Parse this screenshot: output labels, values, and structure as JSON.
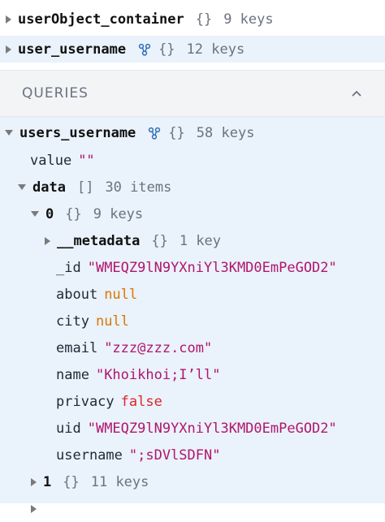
{
  "top_items": [
    {
      "key": "userObject_container",
      "type": "{}",
      "count": "9 keys"
    },
    {
      "key": "user_username",
      "type": "{}",
      "count": "12 keys"
    }
  ],
  "queries": {
    "title": "QUERIES",
    "root": {
      "key": "users_username",
      "type": "{}",
      "count": "58 keys"
    },
    "value": {
      "key": "value",
      "val": "\"\""
    },
    "data": {
      "key": "data",
      "type": "[]",
      "count": "30 items"
    },
    "item0": {
      "key": "0",
      "type": "{}",
      "count": "9 keys"
    },
    "metadata": {
      "key": "__metadata",
      "type": "{}",
      "count": "1 key"
    },
    "fields": [
      {
        "key": "_id",
        "val": "\"WMEQZ9lN9YXniYl3KMD0EmPeGOD2\"",
        "kind": "str"
      },
      {
        "key": "about",
        "val": "null",
        "kind": "null"
      },
      {
        "key": "city",
        "val": "null",
        "kind": "null"
      },
      {
        "key": "email",
        "val": "\"zzz@zzz.com\"",
        "kind": "str"
      },
      {
        "key": "name",
        "val": "\"Khoikhoi;I’ll\"",
        "kind": "str"
      },
      {
        "key": "privacy",
        "val": "false",
        "kind": "bool"
      },
      {
        "key": "uid",
        "val": "\"WMEQZ9lN9YXniYl3KMD0EmPeGOD2\"",
        "kind": "str"
      },
      {
        "key": "username",
        "val": "\";sDVlSDFN\"",
        "kind": "str"
      }
    ],
    "item1": {
      "key": "1",
      "type": "{}",
      "count": "11 keys"
    }
  },
  "colors": {
    "selected_bg": "#eaf2fb",
    "string": "#b0166e",
    "null": "#d97706",
    "bool": "#dc2626",
    "link_icon": "#2f6fb5"
  }
}
